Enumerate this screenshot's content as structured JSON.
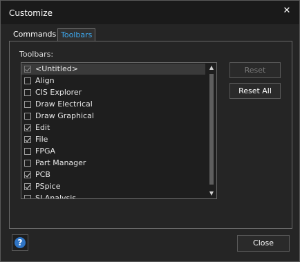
{
  "window": {
    "title": "Customize",
    "close_glyph": "✕"
  },
  "tabs": [
    {
      "label": "Commands",
      "active": false
    },
    {
      "label": "Toolbars",
      "active": true
    }
  ],
  "toolbars_panel": {
    "label": "Toolbars:",
    "items": [
      {
        "label": "<Untitled>",
        "checked": true,
        "selected": true
      },
      {
        "label": "Align",
        "checked": false,
        "selected": false
      },
      {
        "label": "CIS Explorer",
        "checked": false,
        "selected": false
      },
      {
        "label": "Draw Electrical",
        "checked": false,
        "selected": false
      },
      {
        "label": "Draw Graphical",
        "checked": false,
        "selected": false
      },
      {
        "label": "Edit",
        "checked": true,
        "selected": false
      },
      {
        "label": "File",
        "checked": true,
        "selected": false
      },
      {
        "label": "FPGA",
        "checked": false,
        "selected": false
      },
      {
        "label": "Part Manager",
        "checked": false,
        "selected": false
      },
      {
        "label": "PCB",
        "checked": true,
        "selected": false
      },
      {
        "label": "PSpice",
        "checked": true,
        "selected": false
      },
      {
        "label": "SI Analysis",
        "checked": false,
        "selected": false
      }
    ],
    "scroll_up_glyph": "▲",
    "scroll_down_glyph": "▼"
  },
  "buttons": {
    "reset_label": "Reset",
    "reset_enabled": false,
    "reset_all_label": "Reset All",
    "close_label": "Close",
    "help_glyph": "?"
  },
  "colors": {
    "active_tab_text": "#3da9f0",
    "help_icon": "#2f74c4"
  },
  "icons": {
    "close": "close-icon",
    "help": "help-icon",
    "scroll_up": "scroll-up-arrow-icon",
    "scroll_down": "scroll-down-arrow-icon",
    "checkbox": "checkbox-icon"
  }
}
